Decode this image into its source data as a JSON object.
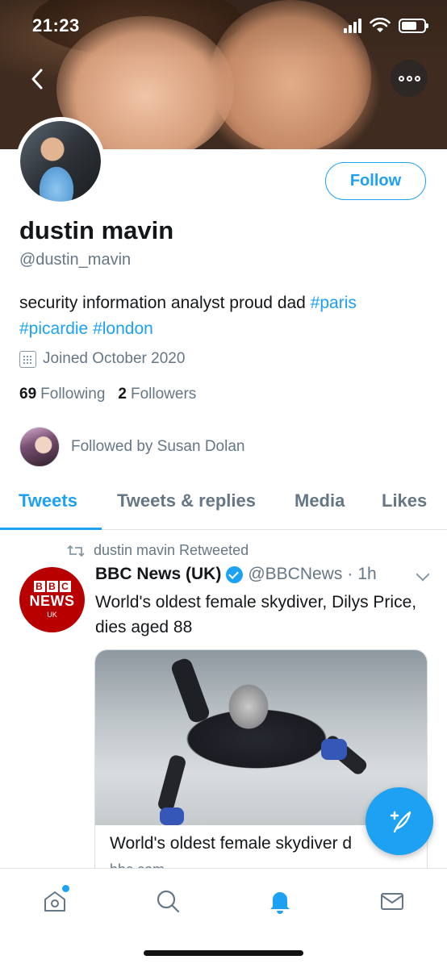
{
  "status_bar": {
    "time": "21:23"
  },
  "profile": {
    "follow_label": "Follow",
    "display_name": "dustin mavin",
    "handle": "@dustin_mavin",
    "bio_text": "security information analyst proud dad ",
    "bio_tags": [
      "#paris",
      "#picardie",
      "#london"
    ],
    "joined": "Joined October 2020",
    "following_count": "69",
    "following_label": "Following",
    "followers_count": "2",
    "followers_label": "Followers",
    "followed_by": "Followed by Susan Dolan"
  },
  "tabs": [
    {
      "label": "Tweets",
      "active": true
    },
    {
      "label": "Tweets & replies",
      "active": false
    },
    {
      "label": "Media",
      "active": false
    },
    {
      "label": "Likes",
      "active": false
    }
  ],
  "tweet": {
    "retweet_line": "dustin mavin Retweeted",
    "author_name": "BBC News (UK)",
    "author_handle": "@BBCNews",
    "separator": "·",
    "time": "1h",
    "text": "World's oldest female skydiver, Dilys Price, dies aged 88",
    "avatar_logo": {
      "boxes": [
        "B",
        "B",
        "C"
      ],
      "news": "NEWS",
      "region": "UK"
    },
    "card": {
      "title": "World's oldest female skydiver d",
      "domain": "bbc.com"
    }
  },
  "colors": {
    "accent": "#1da1f2",
    "bbc_red": "#b80000",
    "secondary_text": "#657786"
  },
  "icons": {
    "back": "chevron-left-icon",
    "more": "more-options-icon",
    "calendar": "calendar-icon",
    "retweet": "retweet-icon",
    "verified": "verified-badge-icon",
    "compose": "compose-tweet-icon",
    "nav": [
      "home-icon",
      "search-icon",
      "notifications-icon",
      "messages-icon"
    ]
  }
}
